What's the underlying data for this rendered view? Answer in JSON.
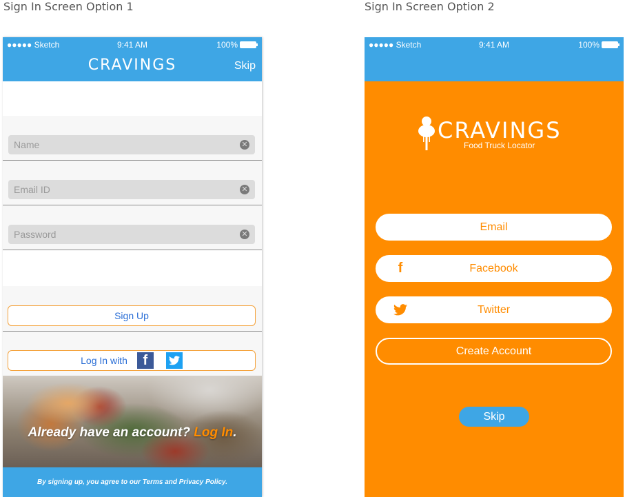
{
  "captions": {
    "option1": "Sign In Screen Option 1",
    "option2": "Sign In Screen Option 2"
  },
  "status_bar": {
    "carrier": "●●●●● Sketch",
    "time": "9:41 AM",
    "battery": "100%"
  },
  "option1": {
    "nav": {
      "title": "CRAVINGS",
      "skip_label": "Skip"
    },
    "fields": {
      "name_placeholder": "Name",
      "email_placeholder": "Email ID",
      "password_placeholder": "Password"
    },
    "sign_up_label": "Sign Up",
    "log_in_with_label": "Log In with",
    "already_text": "Already have an account?",
    "log_in_link": "Log In",
    "already_end": ".",
    "footer_text": "By signing up, you agree to our Terms and Privacy Policy.",
    "icons": [
      "clear-icon",
      "facebook-icon",
      "twitter-icon"
    ]
  },
  "option2": {
    "logo": {
      "word": "CRAVINGS",
      "subtitle": "Food Truck Locator"
    },
    "email_label": "Email",
    "facebook_label": "Facebook",
    "twitter_label": "Twitter",
    "create_account_label": "Create Account",
    "skip_label": "Skip"
  },
  "colors": {
    "blue": "#3ea6e5",
    "orange": "#ff8c00",
    "facebook": "#3b5998",
    "twitter": "#1da1f2"
  }
}
